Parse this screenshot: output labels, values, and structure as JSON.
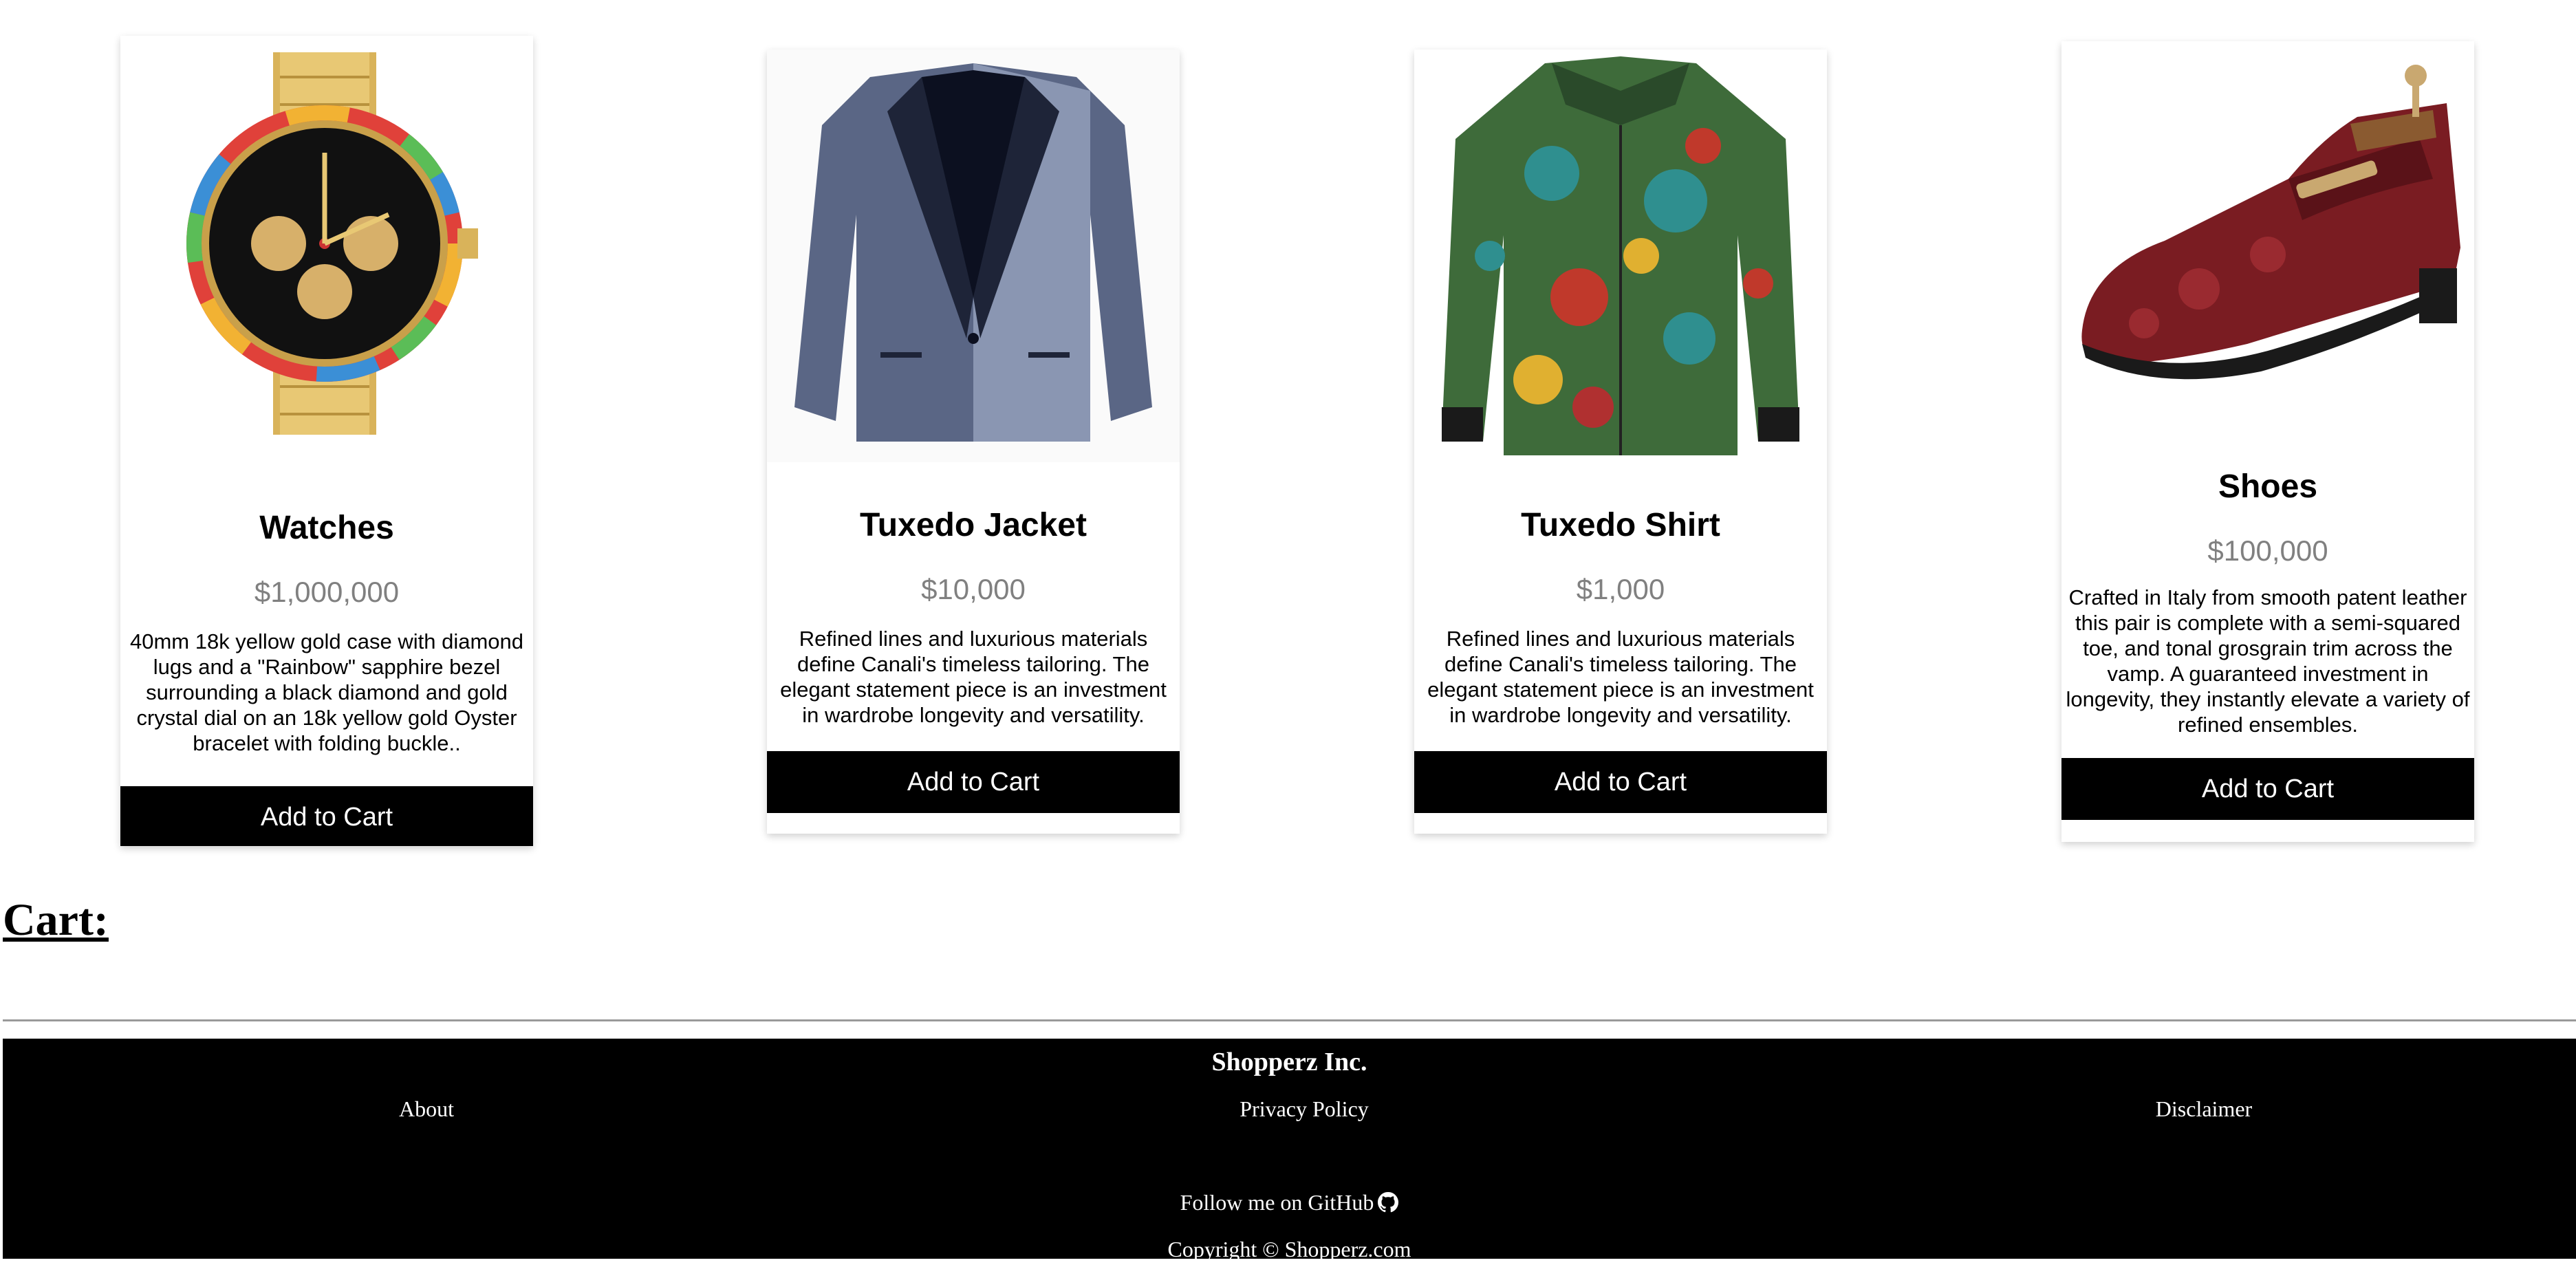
{
  "products": [
    {
      "title": "Watches",
      "price": "$1,000,000",
      "description": "40mm 18k yellow gold case with diamond lugs and a \"Rainbow\" sapphire bezel surrounding a black diamond and gold crystal dial on an 18k yellow gold Oyster bracelet with folding buckle..",
      "button": "Add to Cart",
      "image_icon": "watch-image"
    },
    {
      "title": "Tuxedo Jacket",
      "price": "$10,000",
      "description": "Refined lines and luxurious materials define Canali's timeless tailoring. The elegant statement piece is an investment in wardrobe longevity and versatility.",
      "button": "Add to Cart",
      "image_icon": "jacket-image"
    },
    {
      "title": "Tuxedo Shirt",
      "price": "$1,000",
      "description": "Refined lines and luxurious materials define Canali's timeless tailoring. The elegant statement piece is an investment in wardrobe longevity and versatility.",
      "button": "Add to Cart",
      "image_icon": "shirt-image"
    },
    {
      "title": "Shoes",
      "price": "$100,000",
      "description": "Crafted in Italy from smooth patent leather this pair is complete with a semi-squared toe, and tonal grosgrain trim across the vamp. A guaranteed investment in longevity, they instantly elevate a variety of refined ensembles.",
      "button": "Add to Cart",
      "image_icon": "shoe-image"
    }
  ],
  "cart": {
    "heading": "Cart:"
  },
  "footer": {
    "brand": "Shopperz Inc.",
    "links": {
      "about": "About",
      "privacy": "Privacy Policy",
      "disclaimer": "Disclaimer"
    },
    "follow": "Follow me on GitHub",
    "follow_icon": "github-icon",
    "copyright": "Copyright © Shopperz.com"
  },
  "colors": {
    "button_bg": "#000000",
    "button_text": "#ffffff",
    "price": "#808080",
    "footer_bg": "#000000"
  }
}
